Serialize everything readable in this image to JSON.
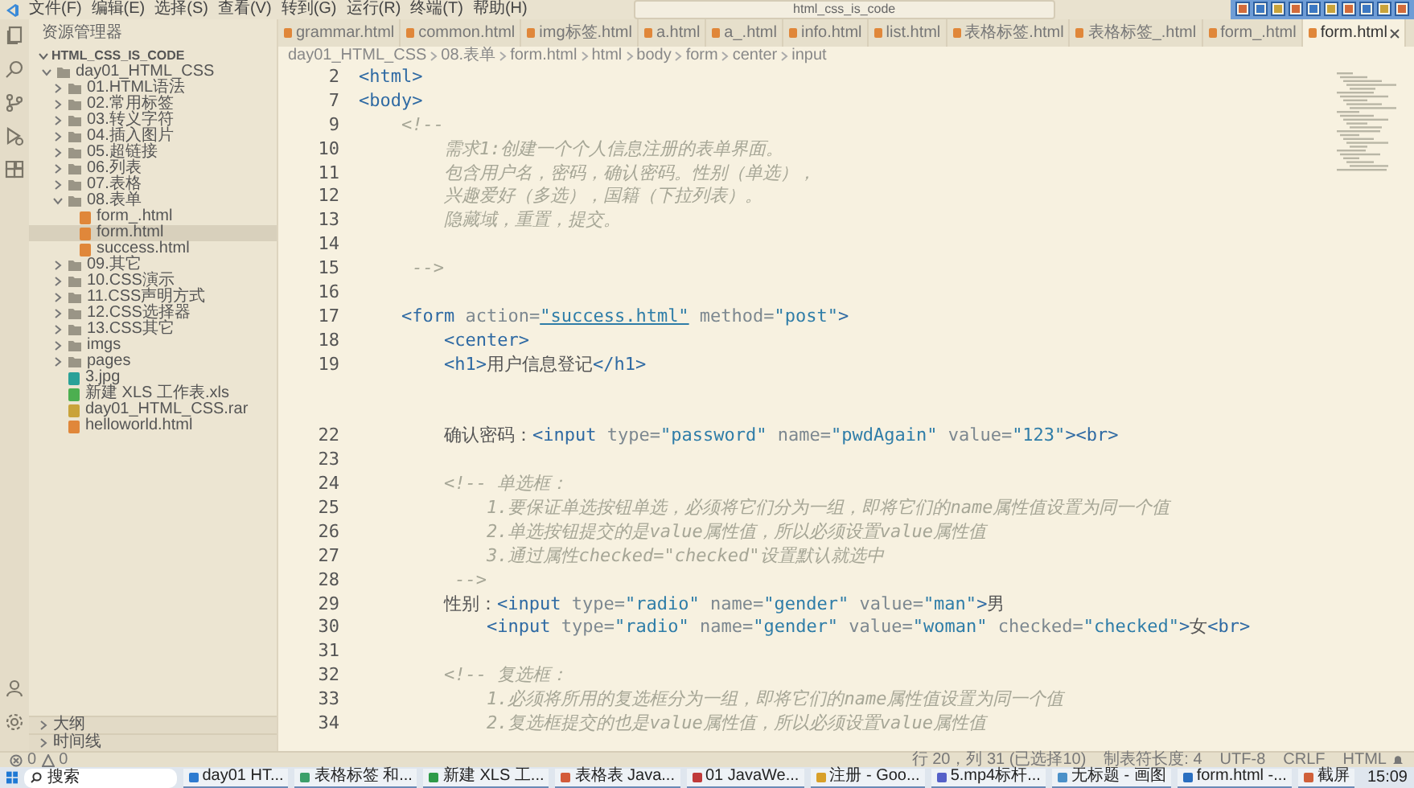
{
  "menu": {
    "items": [
      "文件(F)",
      "编辑(E)",
      "选择(S)",
      "查看(V)",
      "转到(G)",
      "运行(R)",
      "终端(T)",
      "帮助(H)"
    ]
  },
  "search": {
    "value": "html_css_is_code"
  },
  "sidebar": {
    "title": "资源管理器",
    "section": "HTML_CSS_IS_CODE",
    "tree": [
      {
        "label": "day01_HTML_CSS",
        "kind": "folder",
        "expanded": true,
        "selected": false,
        "children": [
          {
            "label": "01.HTML语法",
            "kind": "folder",
            "expanded": false,
            "selected": false
          },
          {
            "label": "02.常用标签",
            "kind": "folder",
            "expanded": false,
            "selected": false
          },
          {
            "label": "03.转义字符",
            "kind": "folder",
            "expanded": false,
            "selected": false
          },
          {
            "label": "04.插入图片",
            "kind": "folder",
            "expanded": false,
            "selected": false
          },
          {
            "label": "05.超链接",
            "kind": "folder",
            "expanded": false,
            "selected": false
          },
          {
            "label": "06.列表",
            "kind": "folder",
            "expanded": false,
            "selected": false
          },
          {
            "label": "07.表格",
            "kind": "folder",
            "expanded": false,
            "selected": false
          },
          {
            "label": "08.表单",
            "kind": "folder",
            "expanded": true,
            "selected": false,
            "children": [
              {
                "label": "form_.html",
                "kind": "html",
                "selected": false
              },
              {
                "label": "form.html",
                "kind": "html",
                "selected": true
              },
              {
                "label": "success.html",
                "kind": "html",
                "selected": false
              }
            ]
          },
          {
            "label": "09.其它",
            "kind": "folder",
            "expanded": false,
            "selected": false
          },
          {
            "label": "10.CSS演示",
            "kind": "folder",
            "expanded": false,
            "selected": false
          },
          {
            "label": "11.CSS声明方式",
            "kind": "folder",
            "expanded": false,
            "selected": false
          },
          {
            "label": "12.CSS选择器",
            "kind": "folder",
            "expanded": false,
            "selected": false
          },
          {
            "label": "13.CSS其它",
            "kind": "folder",
            "expanded": false,
            "selected": false
          },
          {
            "label": "imgs",
            "kind": "folder",
            "expanded": false,
            "selected": false
          },
          {
            "label": "pages",
            "kind": "folder",
            "expanded": false,
            "selected": false
          },
          {
            "label": "3.jpg",
            "kind": "image",
            "selected": false
          },
          {
            "label": "新建 XLS 工作表.xls",
            "kind": "sheet",
            "selected": false
          },
          {
            "label": "day01_HTML_CSS.rar",
            "kind": "archive",
            "selected": false
          },
          {
            "label": "helloworld.html",
            "kind": "html",
            "selected": false
          }
        ]
      }
    ],
    "panels": [
      {
        "label": "大纲",
        "expanded": false
      },
      {
        "label": "时间线",
        "expanded": false
      }
    ]
  },
  "tabs": [
    {
      "label": "grammar.html",
      "selected": false
    },
    {
      "label": "common.html",
      "selected": false
    },
    {
      "label": "img标签.html",
      "selected": false
    },
    {
      "label": "a.html",
      "selected": false
    },
    {
      "label": "a_.html",
      "selected": false
    },
    {
      "label": "info.html",
      "selected": false
    },
    {
      "label": "list.html",
      "selected": false
    },
    {
      "label": "表格标签.html",
      "selected": false
    },
    {
      "label": "表格标签_.html",
      "selected": false
    },
    {
      "label": "form_.html",
      "selected": false
    },
    {
      "label": "form.html",
      "selected": true
    }
  ],
  "breadcrumb": [
    "day01_HTML_CSS",
    "08.表单",
    "form.html",
    "html",
    "body",
    "form",
    "center",
    "input"
  ],
  "code": {
    "lines": [
      {
        "number": "2",
        "segments": [
          {
            "kind": "tag",
            "text": "<html>"
          }
        ]
      },
      {
        "number": "7",
        "segments": [
          {
            "kind": "tag",
            "text": "<body>"
          }
        ]
      },
      {
        "number": "9",
        "segments": [
          {
            "kind": "comment",
            "text": "    <!--"
          }
        ]
      },
      {
        "number": "10",
        "segments": [
          {
            "kind": "comment",
            "text": "        需求1:创建一个个人信息注册的表单界面。"
          }
        ]
      },
      {
        "number": "11",
        "segments": [
          {
            "kind": "comment",
            "text": "        包含用户名，密码，确认密码。性别（单选），"
          }
        ]
      },
      {
        "number": "12",
        "segments": [
          {
            "kind": "comment",
            "text": "        兴趣爱好（多选），国籍（下拉列表）。"
          }
        ]
      },
      {
        "number": "13",
        "segments": [
          {
            "kind": "comment",
            "text": "        隐藏域，重置，提交。"
          }
        ]
      },
      {
        "number": "14"
      },
      {
        "number": "15",
        "segments": [
          {
            "kind": "comment",
            "text": "     -->"
          }
        ]
      },
      {
        "number": "16"
      },
      {
        "number": "17",
        "segments": [
          {
            "kind": "tag",
            "text": "    <form"
          },
          {
            "kind": "attr",
            "text": " action="
          },
          {
            "kind": "link",
            "text": "\"success.html\""
          },
          {
            "kind": "attr",
            "text": " method="
          },
          {
            "kind": "str",
            "text": "\"post\""
          },
          {
            "kind": "tag",
            "text": ">"
          }
        ]
      },
      {
        "number": "18",
        "segments": [
          {
            "kind": "tag",
            "text": "        <center>"
          }
        ]
      },
      {
        "number": "19",
        "segments": [
          {
            "kind": "tag",
            "text": "        <h1>"
          },
          {
            "kind": "text",
            "text": "用户信息登记"
          },
          {
            "kind": "tag",
            "text": "</h1>"
          }
        ]
      },
      {
        "covered": true
      },
      {
        "covered": true
      },
      {
        "number": "22",
        "segments": [
          {
            "kind": "text",
            "text": "        确认密码："
          },
          {
            "kind": "tag",
            "text": "<input"
          },
          {
            "kind": "attr",
            "text": " type="
          },
          {
            "kind": "str",
            "text": "\"password\""
          },
          {
            "kind": "attr",
            "text": " name="
          },
          {
            "kind": "str",
            "text": "\"pwdAgain\""
          },
          {
            "kind": "attr",
            "text": " value="
          },
          {
            "kind": "str",
            "text": "\"123\""
          },
          {
            "kind": "tag",
            "text": "><br>"
          }
        ]
      },
      {
        "number": "23"
      },
      {
        "number": "24",
        "segments": [
          {
            "kind": "comment",
            "text": "        <!-- 单选框："
          }
        ]
      },
      {
        "number": "25",
        "segments": [
          {
            "kind": "comment",
            "text": "            1.要保证单选按钮单选，必须将它们分为一组，即将它们的name属性值设置为同一个值"
          }
        ]
      },
      {
        "number": "26",
        "segments": [
          {
            "kind": "comment",
            "text": "            2.单选按钮提交的是value属性值，所以必须设置value属性值"
          }
        ]
      },
      {
        "number": "27",
        "segments": [
          {
            "kind": "comment",
            "text": "            3.通过属性checked=\"checked\"设置默认就选中"
          }
        ]
      },
      {
        "number": "28",
        "segments": [
          {
            "kind": "comment",
            "text": "         -->"
          }
        ]
      },
      {
        "number": "29",
        "segments": [
          {
            "kind": "text",
            "text": "        性别："
          },
          {
            "kind": "tag",
            "text": "<input"
          },
          {
            "kind": "attr",
            "text": " type="
          },
          {
            "kind": "str",
            "text": "\"radio\""
          },
          {
            "kind": "attr",
            "text": " name="
          },
          {
            "kind": "str",
            "text": "\"gender\""
          },
          {
            "kind": "attr",
            "text": " value="
          },
          {
            "kind": "str",
            "text": "\"man\""
          },
          {
            "kind": "tag",
            "text": ">"
          },
          {
            "kind": "text",
            "text": "男"
          }
        ]
      },
      {
        "number": "30",
        "segments": [
          {
            "kind": "tag",
            "text": "            <input"
          },
          {
            "kind": "attr",
            "text": " type="
          },
          {
            "kind": "str",
            "text": "\"radio\""
          },
          {
            "kind": "attr",
            "text": " name="
          },
          {
            "kind": "str",
            "text": "\"gender\""
          },
          {
            "kind": "attr",
            "text": " value="
          },
          {
            "kind": "str",
            "text": "\"woman\""
          },
          {
            "kind": "attr",
            "text": " checked="
          },
          {
            "kind": "str",
            "text": "\"checked\""
          },
          {
            "kind": "tag",
            "text": ">"
          },
          {
            "kind": "text",
            "text": "女"
          },
          {
            "kind": "tag",
            "text": "<br>"
          }
        ]
      },
      {
        "number": "31"
      },
      {
        "number": "32",
        "segments": [
          {
            "kind": "comment",
            "text": "        <!-- 复选框："
          }
        ]
      },
      {
        "number": "33",
        "segments": [
          {
            "kind": "comment",
            "text": "            1.必须将所用的复选框分为一组，即将它们的name属性值设置为同一个值"
          }
        ]
      },
      {
        "number": "34",
        "segments": [
          {
            "kind": "comment",
            "text": "            2.复选框提交的也是value属性值，所以必须设置value属性值"
          }
        ]
      }
    ]
  },
  "status_bar": {
    "errors": "0",
    "warnings": "0",
    "items": [
      "行 20，列 31 (已选择10)",
      "制表符长度: 4",
      "UTF-8",
      "CRLF",
      "HTML"
    ]
  },
  "taskbar": {
    "search": "搜索",
    "apps": [
      "day01 HT...",
      "表格标签 和...",
      "新建 XLS 工...",
      "表格表 Java...",
      "01 JavaWe...",
      "注册 - Goo...",
      "5.mp4标杆...",
      "无标题 - 画图",
      "form.html -...",
      "截屏"
    ],
    "time": "15:09"
  }
}
